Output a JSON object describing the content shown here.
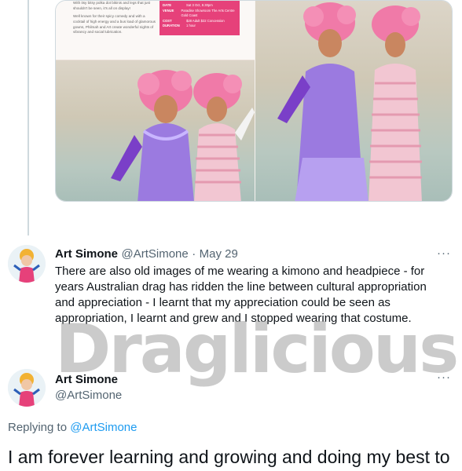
{
  "brochure": {
    "paragraph_1": "With itsy bitsy polka dot bikinis and legs that just shouldn't be seen, it's all on display!",
    "paragraph_2": "Well known for their spicy comedy and with a cocktail of high energy and a bus load of glamorous gowns, Philmah and Art create wonderful nights of vibrancy and social lubrication.",
    "details": [
      {
        "key": "DATE",
        "value": "Sat 3 Oct, 8.30pm"
      },
      {
        "key": "VENUE",
        "value": "Paradise Showroom The Arts Centre Gold Coast"
      },
      {
        "key": "COST",
        "value": "$28 Adult $22 Concession"
      },
      {
        "key": "DURATION",
        "value": "1 hour"
      }
    ]
  },
  "tweet1": {
    "display_name": "Art Simone",
    "handle": "@ArtSimone",
    "separator": "·",
    "date": "May 29",
    "more": "···",
    "text": "There are also old images of me wearing a kimono and headpiece - for years Australian drag has ridden the line between cultural appropriation and appreciation - I learnt that my appreciation could be seen as appropriation, I learnt and grew and I stopped wearing that costume."
  },
  "watermark": "Draglicious",
  "tweet2": {
    "display_name": "Art Simone",
    "handle": "@ArtSimone",
    "more": "···",
    "replying_prefix": "Replying to",
    "replying_to": "@ArtSimone",
    "text": "I am forever learning and growing and doing my best to"
  },
  "colors": {
    "link": "#1d9bf0",
    "muted": "#536471",
    "brochure_accent": "#e6417a"
  }
}
